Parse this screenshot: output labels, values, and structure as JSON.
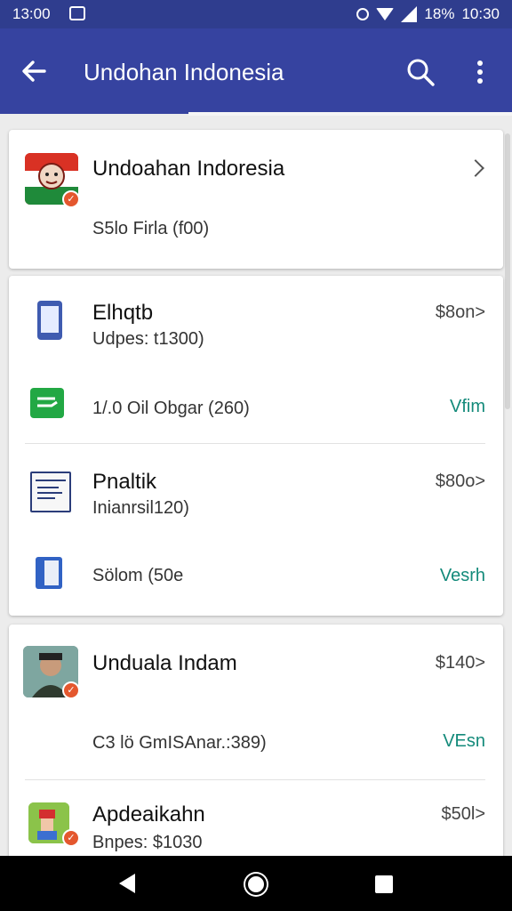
{
  "status_bar": {
    "time": "13:00",
    "battery": "18%",
    "clock": "10:30"
  },
  "app_bar": {
    "title": "Undohan Indonesia"
  },
  "header_card": {
    "title": "Undoahan Indoresia",
    "subtitle": "S5lo Firla (f00)"
  },
  "list": [
    {
      "title": "Elhqtb",
      "subtitle": "Udpes: t1300)",
      "meta": "$8on>"
    },
    {
      "title": "1/.0 Oil Obgar (260)",
      "link": "Vfim"
    },
    {
      "title": "Pnaltik",
      "subtitle": "Inianrsil120)",
      "meta": "$80o>"
    },
    {
      "title": "Sölom (50e",
      "link": "Vesrh"
    },
    {
      "title": "Unduala Indam",
      "meta": "$140>"
    },
    {
      "title": "C3 lö GmISAnar.:389)",
      "link": "VEsn"
    },
    {
      "title": "Apdeaikahn",
      "subtitle": "Bnpes: $1030",
      "meta": "$50l>"
    }
  ],
  "colors": {
    "appbar": "#3643a0",
    "statusbar": "#2f3d8e",
    "link": "#138a7a",
    "badge": "#e4572e"
  }
}
